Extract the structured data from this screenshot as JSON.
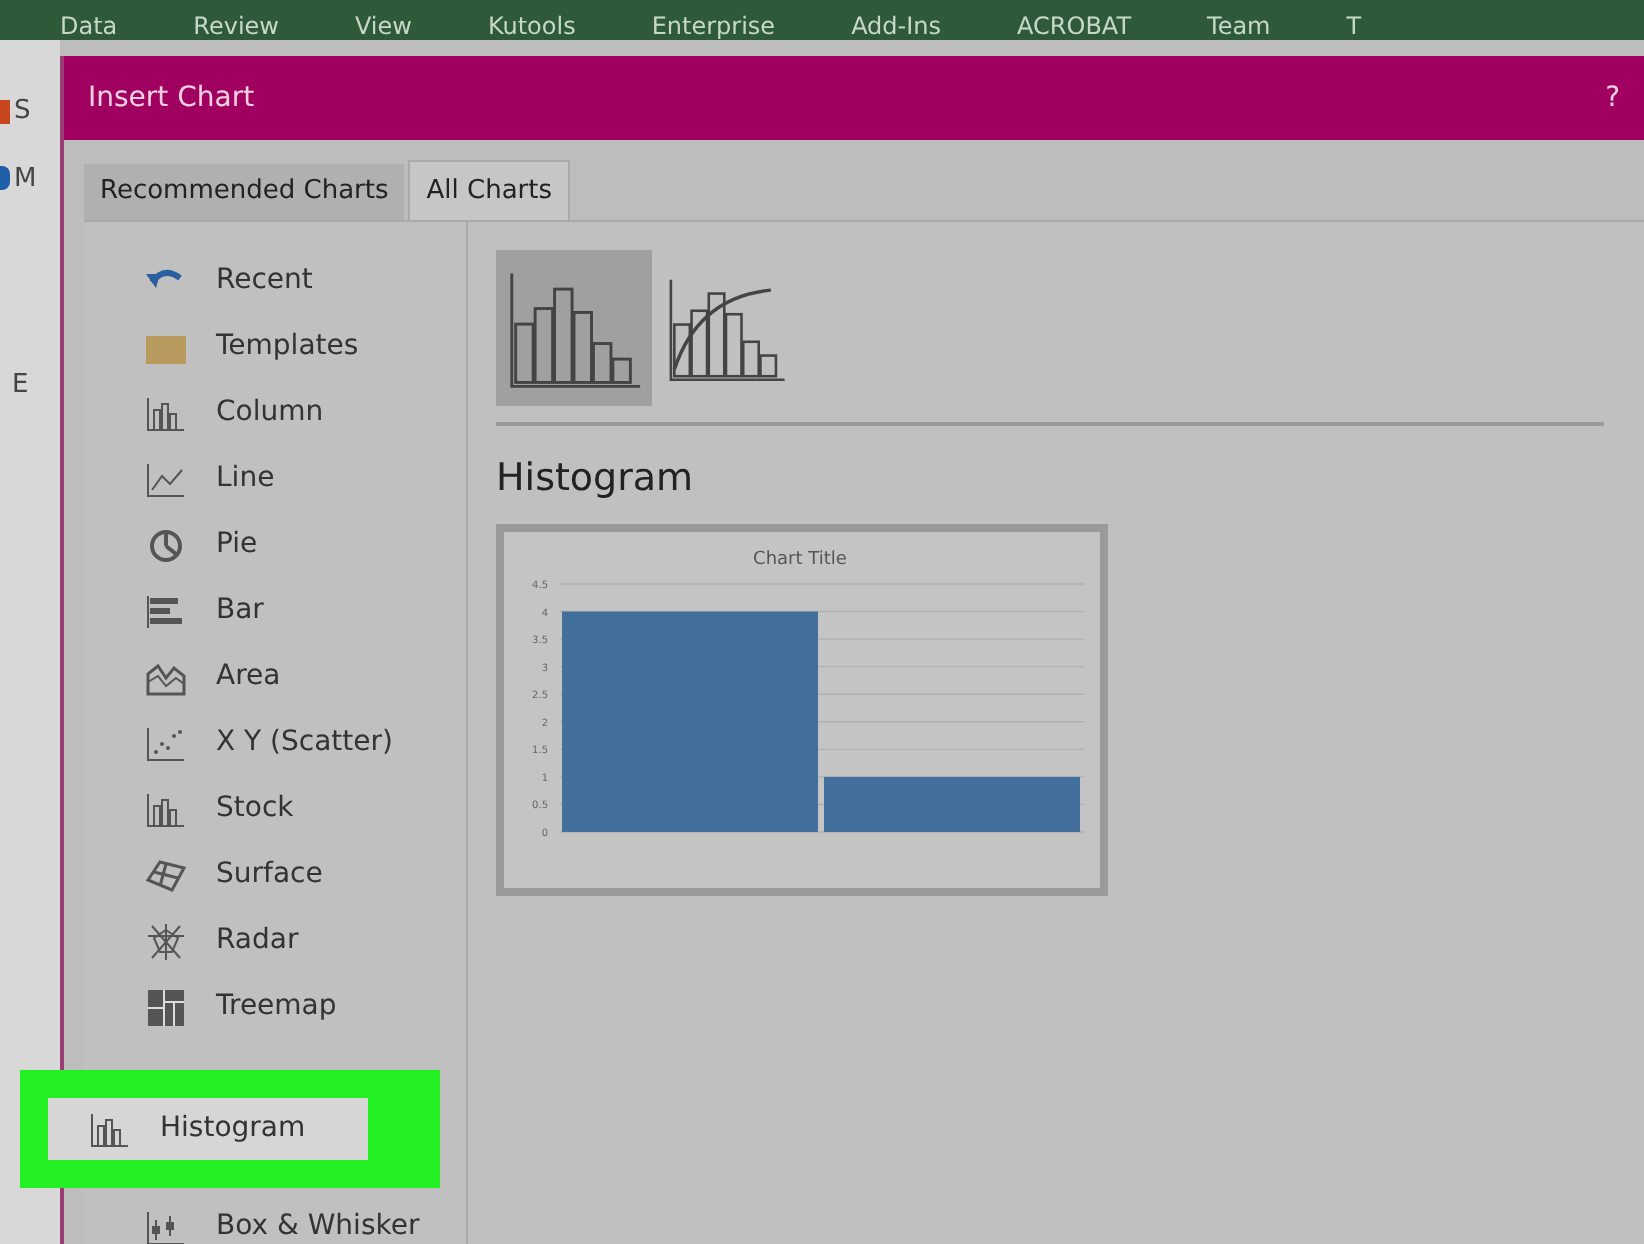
{
  "ribbon": {
    "tabs": [
      "Data",
      "Review",
      "View",
      "Kutools",
      "Enterprise",
      "Add-Ins",
      "ACROBAT",
      "Team",
      "T"
    ]
  },
  "sheet_edge": {
    "labels": [
      "S",
      "M",
      "E"
    ]
  },
  "dialog": {
    "title": "Insert Chart",
    "help": "?"
  },
  "tabs": [
    {
      "label": "Recommended Charts",
      "selected": false
    },
    {
      "label": "All Charts",
      "selected": true
    }
  ],
  "chart_types": [
    {
      "kind": "recent",
      "label": "Recent",
      "selected": false
    },
    {
      "kind": "templates",
      "label": "Templates",
      "selected": false
    },
    {
      "kind": "column",
      "label": "Column",
      "selected": false
    },
    {
      "kind": "line",
      "label": "Line",
      "selected": false
    },
    {
      "kind": "pie",
      "label": "Pie",
      "selected": false
    },
    {
      "kind": "bar",
      "label": "Bar",
      "selected": false
    },
    {
      "kind": "area",
      "label": "Area",
      "selected": false
    },
    {
      "kind": "scatter",
      "label": "X Y (Scatter)",
      "selected": false
    },
    {
      "kind": "stock",
      "label": "Stock",
      "selected": false
    },
    {
      "kind": "surface",
      "label": "Surface",
      "selected": false
    },
    {
      "kind": "radar",
      "label": "Radar",
      "selected": false
    },
    {
      "kind": "treemap",
      "label": "Treemap",
      "selected": false
    },
    {
      "kind": "histogram",
      "label": "Histogram",
      "selected": true
    },
    {
      "kind": "box",
      "label": "Box & Whisker",
      "selected": false
    }
  ],
  "subtypes": [
    {
      "kind": "histogram",
      "selected": true
    },
    {
      "kind": "pareto",
      "selected": false
    }
  ],
  "preview": {
    "heading": "Histogram",
    "chart_data": {
      "type": "bar",
      "title": "Chart Title",
      "values": [
        4,
        1
      ],
      "ylim": [
        0,
        4.5
      ],
      "grid": true,
      "yticks": [
        0,
        0.5,
        1,
        1.5,
        2,
        2.5,
        3,
        3.5,
        4,
        4.5
      ]
    }
  }
}
